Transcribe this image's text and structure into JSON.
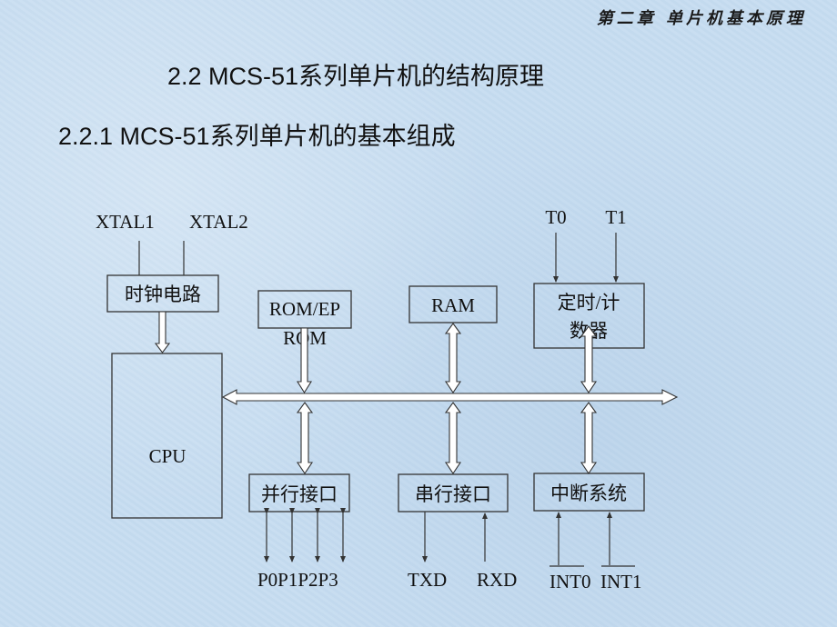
{
  "header": {
    "chapter": "第二章 单片机基本原理"
  },
  "titles": {
    "section": "2.2 MCS-51系列单片机的结构原理",
    "subsection": "2.2.1 MCS-51系列单片机的基本组成"
  },
  "diagram": {
    "inputs": {
      "xtal1": "XTAL1",
      "xtal2": "XTAL2",
      "t0": "T0",
      "t1": "T1"
    },
    "blocks": {
      "clock": "时钟电路",
      "rom_line1": "ROM/EP",
      "rom_line2": "ROM",
      "ram": "RAM",
      "timer_line1": "定时/计",
      "timer_line2": "数器",
      "cpu": "CPU",
      "parallel": "并行接口",
      "serial": "串行接口",
      "interrupt": "中断系统"
    },
    "pins": {
      "ports": "P0P1P2P3",
      "txd": "TXD",
      "rxd": "RXD",
      "int0": "INT0",
      "int1": "INT1"
    }
  }
}
